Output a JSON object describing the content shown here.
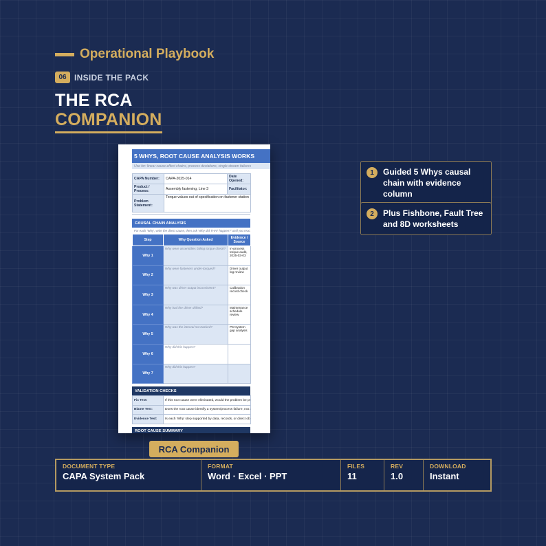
{
  "brand": "Operational Playbook",
  "section": {
    "number": "06",
    "label": "INSIDE THE PACK"
  },
  "title": {
    "line1": "THE RCA",
    "line2": "COMPANION"
  },
  "document": {
    "header": "5 WHYS, ROOT CAUSE ANALYSIS WORKS",
    "subheader": "Use for: linear cause-effect chains, process deviations, single-stream failures",
    "fields": {
      "capa_label": "CAPA Number:",
      "capa_value": "CAPA-2025-014",
      "date_label": "Date Opened:",
      "product_label": "Product / Process:",
      "product_value": "Assembly fastening, Line 3",
      "facilitator_label": "Facilitator:",
      "problem_label": "Problem Statement:",
      "problem_value": "Torque values out of specification on fastener station"
    },
    "causal_title": "CAUSAL CHAIN ANALYSIS",
    "causal_note": "For each 'Why', write the direct cause, then ask 'Why did THAT happen?' until you reach",
    "columns": {
      "step": "Step",
      "question": "Why Question Asked",
      "evidence": "Evidence / Source"
    },
    "rows": [
      {
        "step": "Why 1",
        "question": "Why were assemblies failing torque check?",
        "evidence": "In-process torque audit, 2025-03-03"
      },
      {
        "step": "Why 2",
        "question": "Why were fasteners under-torqued?",
        "evidence": "Driver output log review"
      },
      {
        "step": "Why 3",
        "question": "Why was driver output inconsistent?",
        "evidence": "Calibration record check"
      },
      {
        "step": "Why 4",
        "question": "Why had the driver drifted?",
        "evidence": "Maintenance schedule review"
      },
      {
        "step": "Why 5",
        "question": "Why was the interval not tracked?",
        "evidence": "PM system gap analysis"
      },
      {
        "step": "Why 6",
        "question": "Why did this happen?",
        "evidence": ""
      },
      {
        "step": "Why 7",
        "question": "Why did this happen?",
        "evidence": ""
      }
    ],
    "validation_title": "VALIDATION CHECKS",
    "validation": [
      {
        "label": "Fix Test:",
        "text": "If this root cause were eliminated, would the problem be prevented?"
      },
      {
        "label": "Blame Test:",
        "text": "Does the root cause identify a system/process failure, not a person?"
      },
      {
        "label": "Evidence Test:",
        "text": "Is each 'Why' step supported by data, records, or direct observation?"
      }
    ],
    "summary_title": "ROOT CAUSE SUMMARY"
  },
  "features": [
    {
      "num": "1",
      "text": "Guided 5 Whys causal chain with evidence column"
    },
    {
      "num": "2",
      "text": "Plus Fishbone, Fault Tree and 8D worksheets"
    }
  ],
  "caption": "RCA Companion",
  "meta": [
    {
      "label": "DOCUMENT TYPE",
      "value": "CAPA System Pack"
    },
    {
      "label": "FORMAT",
      "value": "Word · Excel · PPT"
    },
    {
      "label": "FILES",
      "value": "11"
    },
    {
      "label": "REV",
      "value": "1.0"
    },
    {
      "label": "DOWNLOAD",
      "value": "Instant"
    }
  ],
  "colors": {
    "background": "#1b2b52",
    "gold": "#d4ad5e",
    "doc_blue": "#4472c4",
    "doc_light": "#dce6f4",
    "doc_navy": "#1f3864"
  }
}
